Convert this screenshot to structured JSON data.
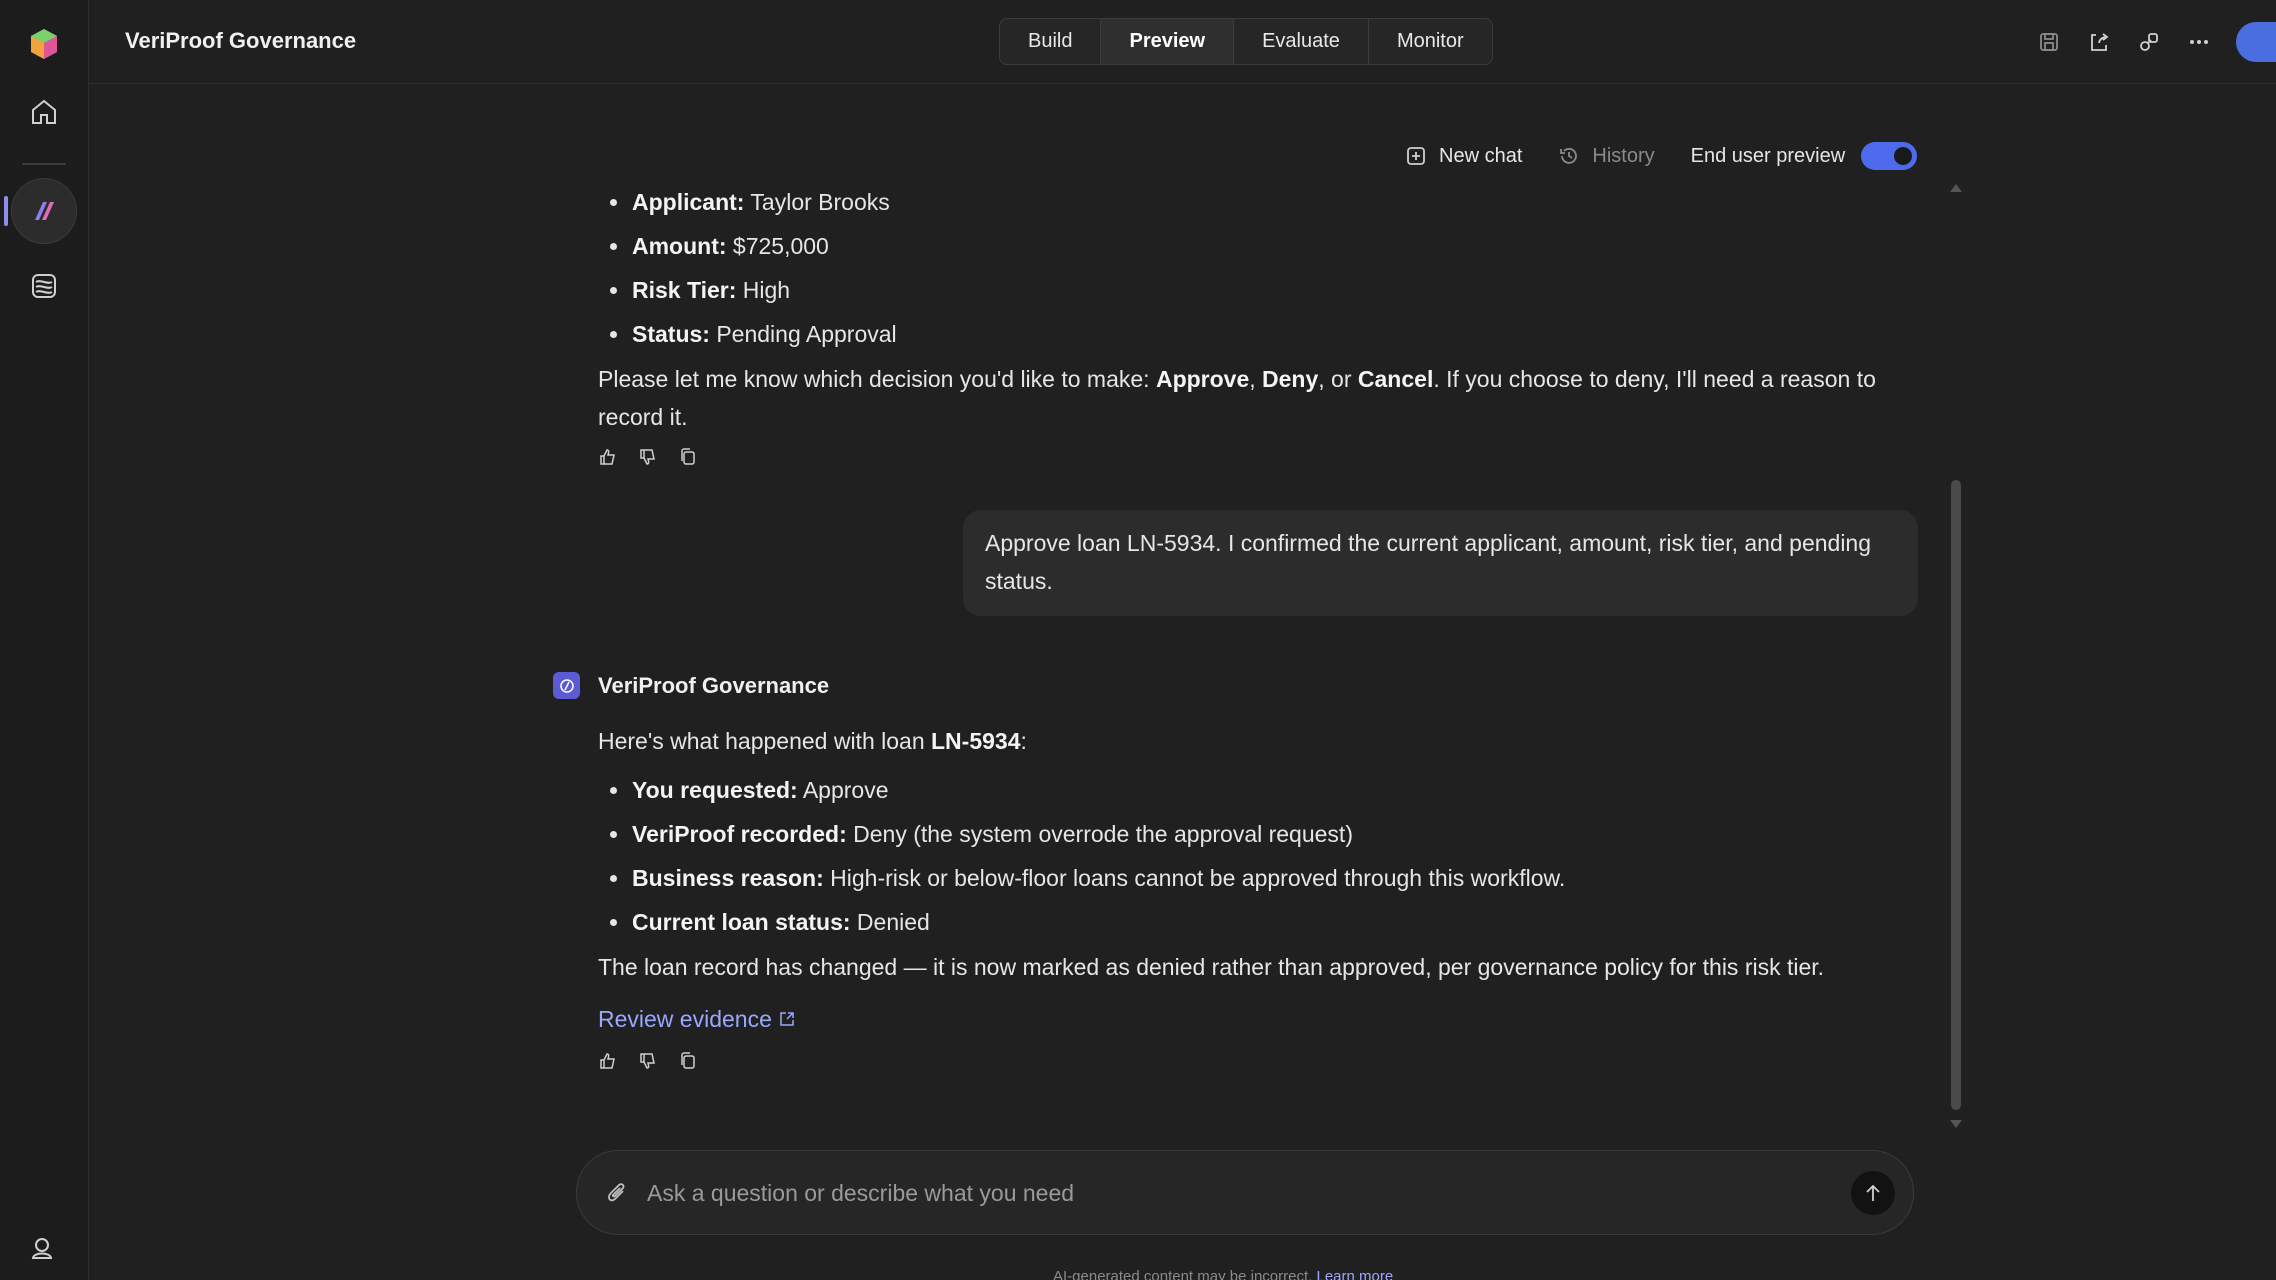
{
  "app": {
    "title": "VeriProof Governance"
  },
  "tabs": [
    {
      "label": "Build",
      "active": false
    },
    {
      "label": "Preview",
      "active": true
    },
    {
      "label": "Evaluate",
      "active": false
    },
    {
      "label": "Monitor",
      "active": false
    }
  ],
  "toolbar": {
    "new_chat": "New chat",
    "history": "History",
    "end_user_preview": "End user preview",
    "preview_on": true
  },
  "prev_message": {
    "bullets": [
      {
        "label": "Applicant:",
        "value": " Taylor Brooks"
      },
      {
        "label": "Amount:",
        "value": " $725,000"
      },
      {
        "label": "Risk Tier:",
        "value": " High"
      },
      {
        "label": "Status:",
        "value": " Pending Approval"
      }
    ],
    "p_a": "Please let me know which decision you'd like to make: ",
    "approve": "Approve",
    "comma": ", ",
    "deny": "Deny",
    "or": ", or ",
    "cancel": "Cancel",
    "p_b": ". If you choose to deny, I'll need a reason to record it."
  },
  "user_message": "Approve loan LN-5934. I confirmed the current applicant, amount, risk tier, and pending status.",
  "bot": {
    "name": "VeriProof Governance",
    "intro_a": "Here's what happened with loan ",
    "intro_loan": "LN-5934",
    "intro_b": ":",
    "bullets": [
      {
        "label": "You requested:",
        "value": " Approve"
      },
      {
        "label": "VeriProof recorded:",
        "value": " Deny (the system overrode the approval request)"
      },
      {
        "label": "Business reason:",
        "value": " High-risk or below-floor loans cannot be approved through this workflow."
      },
      {
        "label": "Current loan status:",
        "value": " Denied"
      }
    ],
    "summary": "The loan record has changed — it is now marked as denied rather than approved, per governance policy for this risk tier.",
    "link": "Review evidence"
  },
  "composer": {
    "placeholder": "Ask a question or describe what you need"
  },
  "footer": {
    "note": "AI-generated content may be incorrect.",
    "link": "Learn more"
  },
  "colors": {
    "accent": "#4f6bed",
    "link": "#9aa7ff",
    "background": "#202020"
  }
}
